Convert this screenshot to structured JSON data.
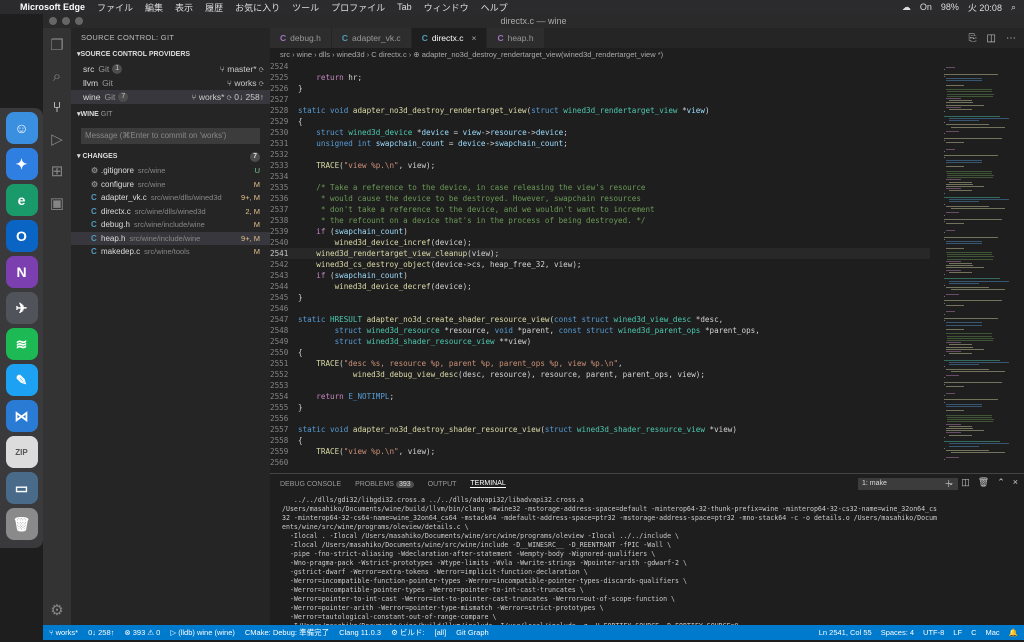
{
  "menubar": {
    "app": "Microsoft Edge",
    "items": [
      "ファイル",
      "編集",
      "表示",
      "履歴",
      "お気に入り",
      "ツール",
      "プロファイル",
      "Tab",
      "ウィンドウ",
      "ヘルプ"
    ],
    "status": {
      "wifi": "On",
      "battery": "98%",
      "clock": "火 20:08"
    }
  },
  "window": {
    "title": "directx.c — wine"
  },
  "sidebar": {
    "title": "SOURCE CONTROL: GIT",
    "providers_header": "SOURCE CONTROL PROVIDERS",
    "providers": [
      {
        "name": "src",
        "kind": "Git",
        "badge": "1",
        "branch": "master*"
      },
      {
        "name": "llvm",
        "kind": "Git",
        "badge": "",
        "branch": "works"
      },
      {
        "name": "wine",
        "kind": "Git",
        "badge": "7",
        "branch": "works*",
        "sync": "0↓ 258↑"
      }
    ],
    "repo_header": "WINE",
    "repo_kind": "GIT",
    "message_placeholder": "Message (⌘Enter to commit on 'works')",
    "changes_header": "CHANGES",
    "changes_count": "7",
    "files": [
      {
        "icon": "⚙",
        "name": ".gitignore",
        "path": "src/wine",
        "status": "U",
        "color": "#73c991"
      },
      {
        "icon": "⚙",
        "name": "configure",
        "path": "src/wine",
        "status": "M",
        "color": "#e2c08d"
      },
      {
        "icon": "C",
        "name": "adapter_vk.c",
        "path": "src/wine/dlls/wined3d",
        "status": "9+, M",
        "color": "#e2c08d"
      },
      {
        "icon": "C",
        "name": "directx.c",
        "path": "src/wine/dlls/wined3d",
        "status": "2, M",
        "color": "#e2c08d"
      },
      {
        "icon": "C",
        "name": "debug.h",
        "path": "src/wine/include/wine",
        "status": "M",
        "color": "#e2c08d"
      },
      {
        "icon": "C",
        "name": "heap.h",
        "path": "src/wine/include/wine",
        "status": "9+, M",
        "color": "#e2c08d"
      },
      {
        "icon": "C",
        "name": "makedep.c",
        "path": "src/wine/tools",
        "status": "M",
        "color": "#e2c08d"
      }
    ]
  },
  "tabs": [
    {
      "label": "debug.h",
      "active": false
    },
    {
      "label": "adapter_vk.c",
      "active": false
    },
    {
      "label": "directx.c",
      "active": true
    },
    {
      "label": "heap.h",
      "active": false
    }
  ],
  "breadcrumbs": "src › wine › dlls › wined3d › C directx.c › ⊕ adapter_no3d_destroy_rendertarget_view(wined3d_rendertarget_view *)",
  "code": {
    "start": 2524,
    "current": 2541,
    "lines": [
      [],
      [
        [
          "    ",
          "#d4d4d4"
        ],
        [
          "return",
          "#c586c0"
        ],
        [
          " hr;",
          "#d4d4d4"
        ]
      ],
      [
        [
          "}",
          "#d4d4d4"
        ]
      ],
      [],
      [
        [
          "static void ",
          "#569cd6"
        ],
        [
          "adapter_no3d_destroy_rendertarget_view",
          "#dcdcaa"
        ],
        [
          "(",
          "#d4d4d4"
        ],
        [
          "struct ",
          "#569cd6"
        ],
        [
          "wined3d_rendertarget_view ",
          "#4ec9b0"
        ],
        [
          "*",
          "#d4d4d4"
        ],
        [
          "view",
          "#9cdcfe"
        ],
        [
          ")",
          "#d4d4d4"
        ]
      ],
      [
        [
          "{",
          "#d4d4d4"
        ]
      ],
      [
        [
          "    ",
          "#d4d4d4"
        ],
        [
          "struct ",
          "#569cd6"
        ],
        [
          "wined3d_device ",
          "#4ec9b0"
        ],
        [
          "*",
          "#d4d4d4"
        ],
        [
          "device",
          "#9cdcfe"
        ],
        [
          " = ",
          "#d4d4d4"
        ],
        [
          "view",
          "#9cdcfe"
        ],
        [
          "->",
          "#d4d4d4"
        ],
        [
          "resource",
          "#9cdcfe"
        ],
        [
          "->",
          "#d4d4d4"
        ],
        [
          "device",
          "#9cdcfe"
        ],
        [
          ";",
          "#d4d4d4"
        ]
      ],
      [
        [
          "    ",
          "#d4d4d4"
        ],
        [
          "unsigned int ",
          "#569cd6"
        ],
        [
          "swapchain_count",
          "#9cdcfe"
        ],
        [
          " = ",
          "#d4d4d4"
        ],
        [
          "device",
          "#9cdcfe"
        ],
        [
          "->",
          "#d4d4d4"
        ],
        [
          "swapchain_count",
          "#9cdcfe"
        ],
        [
          ";",
          "#d4d4d4"
        ]
      ],
      [],
      [
        [
          "    ",
          "#d4d4d4"
        ],
        [
          "TRACE",
          "#dcdcaa"
        ],
        [
          "(",
          "#d4d4d4"
        ],
        [
          "\"view %p.\\n\"",
          "#ce9178"
        ],
        [
          ", view);",
          "#d4d4d4"
        ]
      ],
      [],
      [
        [
          "    /* Take a reference to the device, in case releasing the view's resource",
          "#6a9955"
        ]
      ],
      [
        [
          "     * would cause the device to be destroyed. However, swapchain resources",
          "#6a9955"
        ]
      ],
      [
        [
          "     * don't take a reference to the device, and we wouldn't want to increment",
          "#6a9955"
        ]
      ],
      [
        [
          "     * the refcount on a device that's in the process of being destroyed. */",
          "#6a9955"
        ]
      ],
      [
        [
          "    ",
          "#d4d4d4"
        ],
        [
          "if",
          "#c586c0"
        ],
        [
          " (",
          "#d4d4d4"
        ],
        [
          "swapchain_count",
          "#9cdcfe"
        ],
        [
          ")",
          "#d4d4d4"
        ]
      ],
      [
        [
          "        ",
          "#d4d4d4"
        ],
        [
          "wined3d_device_incref",
          "#dcdcaa"
        ],
        [
          "(device);",
          "#d4d4d4"
        ]
      ],
      [
        [
          "    ",
          "#d4d4d4"
        ],
        [
          "wined3d_rendertarget_view_cleanup",
          "#dcdcaa"
        ],
        [
          "(view);",
          "#d4d4d4"
        ]
      ],
      [
        [
          "    ",
          "#d4d4d4"
        ],
        [
          "wined3d_cs_destroy_object",
          "#dcdcaa"
        ],
        [
          "(device->cs, heap_free_32, view);",
          "#d4d4d4"
        ]
      ],
      [
        [
          "    ",
          "#d4d4d4"
        ],
        [
          "if",
          "#c586c0"
        ],
        [
          " (",
          "#d4d4d4"
        ],
        [
          "swapchain_count",
          "#9cdcfe"
        ],
        [
          ")",
          "#d4d4d4"
        ]
      ],
      [
        [
          "        ",
          "#d4d4d4"
        ],
        [
          "wined3d_device_decref",
          "#dcdcaa"
        ],
        [
          "(device);",
          "#d4d4d4"
        ]
      ],
      [
        [
          "}",
          "#d4d4d4"
        ]
      ],
      [],
      [
        [
          "static ",
          "#569cd6"
        ],
        [
          "HRESULT ",
          "#4ec9b0"
        ],
        [
          "adapter_no3d_create_shader_resource_view",
          "#dcdcaa"
        ],
        [
          "(",
          "#d4d4d4"
        ],
        [
          "const struct ",
          "#569cd6"
        ],
        [
          "wined3d_view_desc ",
          "#4ec9b0"
        ],
        [
          "*desc,",
          "#d4d4d4"
        ]
      ],
      [
        [
          "        ",
          "#d4d4d4"
        ],
        [
          "struct ",
          "#569cd6"
        ],
        [
          "wined3d_resource ",
          "#4ec9b0"
        ],
        [
          "*resource, ",
          "#d4d4d4"
        ],
        [
          "void ",
          "#569cd6"
        ],
        [
          "*parent, ",
          "#d4d4d4"
        ],
        [
          "const struct ",
          "#569cd6"
        ],
        [
          "wined3d_parent_ops ",
          "#4ec9b0"
        ],
        [
          "*parent_ops,",
          "#d4d4d4"
        ]
      ],
      [
        [
          "        ",
          "#d4d4d4"
        ],
        [
          "struct ",
          "#569cd6"
        ],
        [
          "wined3d_shader_resource_view ",
          "#4ec9b0"
        ],
        [
          "**view)",
          "#d4d4d4"
        ]
      ],
      [
        [
          "{",
          "#d4d4d4"
        ]
      ],
      [
        [
          "    ",
          "#d4d4d4"
        ],
        [
          "TRACE",
          "#dcdcaa"
        ],
        [
          "(",
          "#d4d4d4"
        ],
        [
          "\"desc %s, resource %p, parent %p, parent_ops %p, view %p.\\n\"",
          "#ce9178"
        ],
        [
          ",",
          "#d4d4d4"
        ]
      ],
      [
        [
          "            ",
          "#d4d4d4"
        ],
        [
          "wined3d_debug_view_desc",
          "#dcdcaa"
        ],
        [
          "(desc, resource), resource, parent, parent_ops, view);",
          "#d4d4d4"
        ]
      ],
      [],
      [
        [
          "    ",
          "#d4d4d4"
        ],
        [
          "return ",
          "#c586c0"
        ],
        [
          "E_NOTIMPL",
          "#569cd6"
        ],
        [
          ";",
          "#d4d4d4"
        ]
      ],
      [
        [
          "}",
          "#d4d4d4"
        ]
      ],
      [],
      [
        [
          "static void ",
          "#569cd6"
        ],
        [
          "adapter_no3d_destroy_shader_resource_view",
          "#dcdcaa"
        ],
        [
          "(",
          "#d4d4d4"
        ],
        [
          "struct ",
          "#569cd6"
        ],
        [
          "wined3d_shader_resource_view ",
          "#4ec9b0"
        ],
        [
          "*view)",
          "#d4d4d4"
        ]
      ],
      [
        [
          "{",
          "#d4d4d4"
        ]
      ],
      [
        [
          "    ",
          "#d4d4d4"
        ],
        [
          "TRACE",
          "#dcdcaa"
        ],
        [
          "(",
          "#d4d4d4"
        ],
        [
          "\"view %p.\\n\"",
          "#ce9178"
        ],
        [
          ", view);",
          "#d4d4d4"
        ]
      ],
      [
        [
          "",
          "#d4d4d4"
        ]
      ]
    ]
  },
  "panel": {
    "tabs": [
      "DEBUG CONSOLE",
      "PROBLEMS",
      "OUTPUT",
      "TERMINAL"
    ],
    "problems_count": "393",
    "active_tab": "TERMINAL",
    "terminal_select": "1: make",
    "terminal_lines": [
      "   ../../dlls/gdi32/libgdi32.cross.a ../../dlls/advapi32/libadvapi32.cross.a",
      "/Users/masahiko/Documents/wine/build/llvm/bin/clang -mwine32 -mstorage-address-space=default -minterop64-32-thunk-prefix=wine -minterop64-32-cs32-name=wine_32on64_cs",
      "32 -minterop64-32-cs64-name=wine_32on64_cs64 -mstack64 -mdefault-address-space=ptr32 -mstorage-address-space=ptr32 -mno-stack64 -c -o details.o /Users/masahiko/Docum",
      "ents/wine/src/wine/programs/oleview/details.c \\",
      "  -Ilocal . -Ilocal /Users/masahiko/Documents/wine/src/wine/programs/oleview -Ilocal ../../include \\",
      "  -Ilocal /Users/masahiko/Documents/wine/src/wine/include -D__WINESRC__ -D_REENTRANT -fPIC -Wall \\",
      "  -pipe -fno-strict-aliasing -Wdeclaration-after-statement -Wempty-body -Wignored-qualifiers \\",
      "  -Wno-pragma-pack -Wstrict-prototypes -Wtype-limits -Wvla -Wwrite-strings -Wpointer-arith -gdwarf-2 \\",
      "  -gstrict-dwarf -Werror=extra-tokens -Werror=implicit-function-declaration \\",
      "  -Werror=incompatible-function-pointer-types -Werror=incompatible-pointer-types-discards-qualifiers \\",
      "  -Werror=incompatible-pointer-types -Werror=pointer-to-int-cast-truncates \\",
      "  -Werror=pointer-to-int-cast -Werror=int-to-pointer-cast-truncates -Werror=out-of-scope-function \\",
      "  -Werror=pointer-arith -Werror=pointer-type-mismatch -Werror=strict-prototypes \\",
      "  -Werror=tautological-constant-out-of-range-compare \\",
      "  -I/Users/masahiko/Documents/wine/build/llvm/include -I/usr/local/include -g -U_FORTIFY_SOURCE -D_FORTIFY_SOURCE=0",
      "▯"
    ]
  },
  "statusbar": {
    "branch": "works*",
    "sync": "0↓ 258↑",
    "problems": "⊗ 393 ⚠ 0",
    "debug": "▷ (lldb) wine (wine)",
    "cmake": "CMake: Debug: 準備完了",
    "clang": "Clang 11.0.3",
    "build": "⚙ ビルド:",
    "all": "[all]",
    "git_graph": "Git Graph",
    "position": "Ln 2541, Col 55",
    "spaces": "Spaces: 4",
    "encoding": "UTF-8",
    "eol": "LF",
    "lang": "C",
    "platform": "Mac"
  }
}
